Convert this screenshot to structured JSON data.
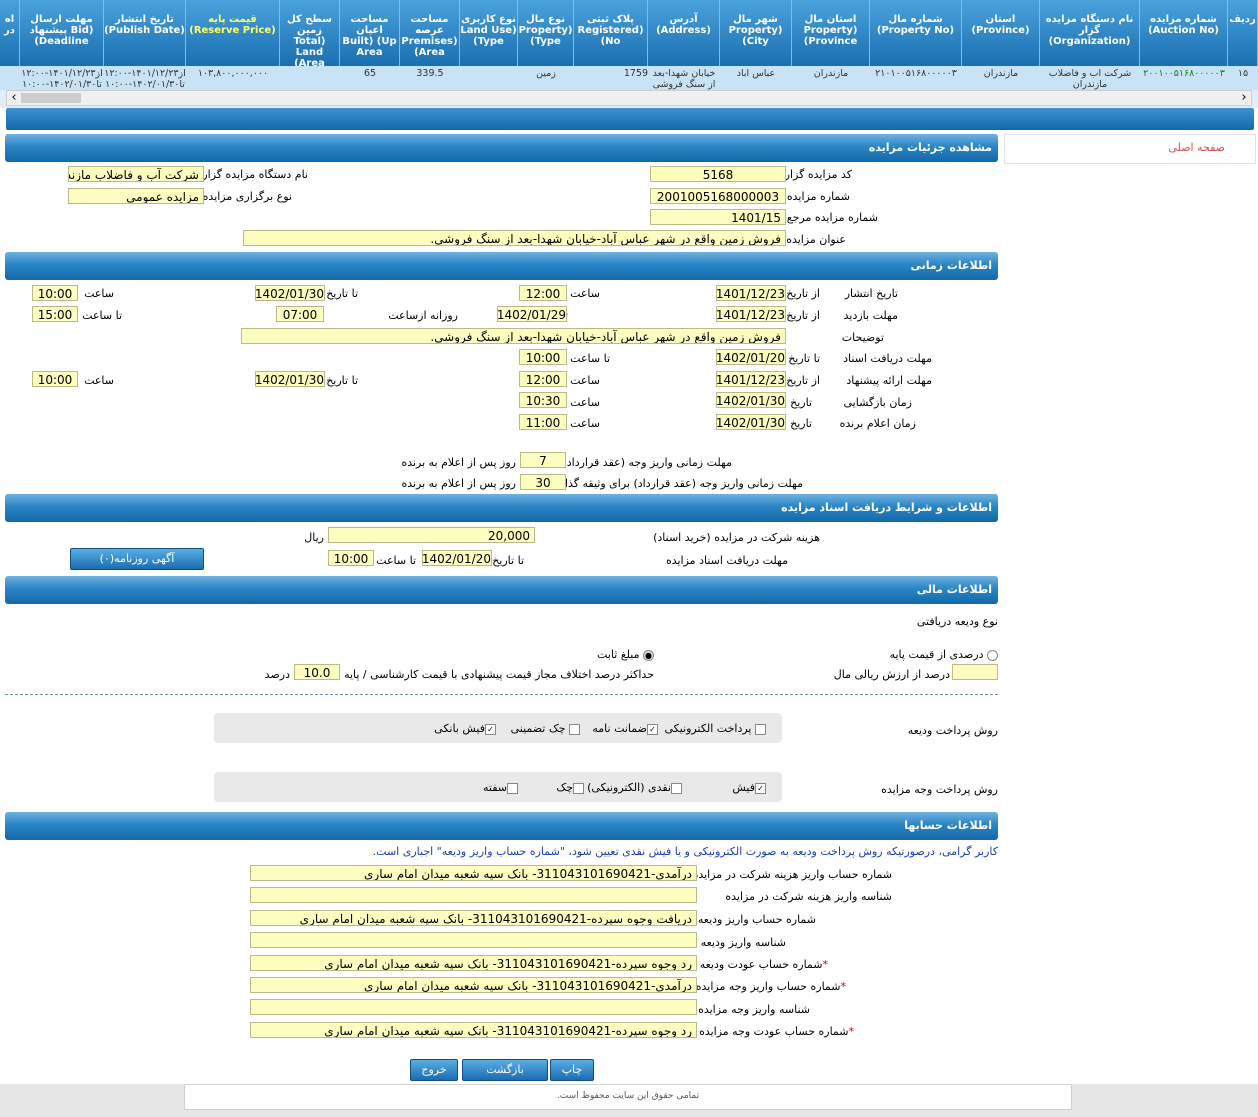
{
  "grid": {
    "headers": [
      "ردیف",
      "شماره مزایده (Auction No)",
      "نام دستگاه مزایده گزار (Organization)",
      "استان (Province)",
      "شماره مال (Property No)",
      "استان مال Property) (Province",
      "شهر مال Property) (City",
      "آدرس (Address)",
      "پلاک ثبتی Registered) (No",
      "نوع مال Property) (Type",
      "نوع کاربری Land Use) (Type",
      "مساحت عرصه Premises) (Area",
      "مساحت اعیان Built) (Up Area",
      "سطح کل زمین Total) Land (Area",
      "قیمت پایه (Reserve Price)",
      "تاریخ انتشار (Publish Date)",
      "مهلت ارسال پیشنهاد Bid) (Deadline",
      "اه در"
    ],
    "row": {
      "index": "۱۵",
      "auction_no": "۲۰۰۱۰۰۵۱۶۸۰۰۰۰۰۳",
      "organization": "شرکت آب و فاضلاب مازندران",
      "province": "مازندران",
      "property_no": "۲۱۰۱۰۰۵۱۶۸۰۰۰۰۰۳",
      "property_province": "مازندران",
      "property_city": "عباس آباد",
      "address": "خیابان شهدا-بعد از سنگ فروشی",
      "registered_no": "1759",
      "property_type": "زمین",
      "land_use": "",
      "premises_area": "339.5",
      "built_area": "65",
      "total_area": "",
      "reserve_price": "۱۰۳,۸۰۰,۰۰۰,۰۰۰",
      "publish_date": "از۱۴۰۱/۱۲/۲۳-۱۲:۰۰ تا۱۴۰۲/۰۱/۳۰-۱۰:۰۰",
      "deadline": "از۱۴۰۱/۱۲/۲۳-۱۲:۰۰ تا۱۴۰۲/۰۱/۳۰-۱۰:۰۰"
    },
    "scroll_left": "‹",
    "scroll_right": "›"
  },
  "home_link": "صفحه اصلی",
  "sections": {
    "details": "مشاهده جزئیات مزایده",
    "time": "اطلاعات زمانی",
    "docs": "اطلاعات و شرایط دریافت اسناد مزایده",
    "financial": "اطلاعات مالی",
    "accounts": "اطلاعات حسابها"
  },
  "details": {
    "org_code_label": "کد مزایده گزار",
    "org_code": "5168",
    "org_name_label": "نام دستگاه مزایده گزار",
    "org_name": "شرکت آب و فاضلاب مازندر",
    "auction_no_label": "شماره مزایده",
    "auction_no": "2001005168000003",
    "holding_type_label": "نوع برگزاری مزایده",
    "holding_type": "مزایده عمومی",
    "ref_no_label": "شماره مزایده مرجع",
    "ref_no": "1401/15",
    "title_label": "عنوان مزایده",
    "title": "فروش زمین واقع در شهر عباس آباد-خیابان شهدا-بعد از سنگ فروشی."
  },
  "time": {
    "publish_label": "تاریخ انتشار",
    "from_date": "از تاریخ",
    "to_date": "تا تاریخ",
    "hour": "ساعت",
    "to_hour": "تا ساعت",
    "date": "تاریخ",
    "publish_from": "1401/12/23",
    "publish_from_time": "12:00",
    "publish_to": "1402/01/30",
    "publish_to_time": "10:00",
    "visit_label": "مهلت بازدید",
    "visit_from": "1401/12/23",
    "visit_to": "1402/01/29",
    "daily_from_label": "روزانه ازساعت",
    "visit_daily_from": "07:00",
    "visit_daily_to": "15:00",
    "description_label": "توضیحات",
    "description": "فروش زمین واقع در شهر عباس آباد-خیابان شهدا-بعد از سنگ فروشی.",
    "doc_deadline_label": "مهلت دریافت اسناد",
    "doc_deadline_date": "1402/01/20",
    "doc_deadline_time": "10:00",
    "bid_label": "مهلت ارائه پیشنهاد",
    "bid_from": "1401/12/23",
    "bid_from_time": "12:00",
    "bid_to": "1402/01/30",
    "bid_to_time": "10:00",
    "opening_label": "زمان بازگشایی",
    "opening_date": "1402/01/30",
    "opening_time": "10:30",
    "winner_label": "زمان اعلام برنده",
    "winner_date": "1402/01/30",
    "winner_time": "11:00",
    "payment_label": "مهلت زمانی واریز وجه (عقد قرارداد)",
    "payment_days": "7",
    "payment_suffix": "روز پس از اعلام به برنده",
    "guarantee_label": "مهلت زمانی واریز وجه (عقد قرارداد) برای وثیقه گذار",
    "guarantee_days": "30",
    "guarantee_suffix": "روز پس از اعلام به برنده"
  },
  "docs": {
    "fee_label": "هزینه شرکت در مزایده (خرید اسناد)",
    "fee": "20,000",
    "currency": "ریال",
    "deadline_label": "مهلت دریافت اسناد مزایده",
    "to_date": "تا تاریخ",
    "deadline_date": "1402/01/20",
    "to_hour": "تا ساعت",
    "deadline_time": "10:00",
    "newspaper_button": "آگهی روزنامه(۰)"
  },
  "financial": {
    "deposit_type_label": "نوع ودیعه دریافتی",
    "percent_of_base": "درصدی از قیمت پایه",
    "fixed_amount": "مبلغ ثابت",
    "percent_of_value_label": "درصد از ارزش ریالی مال",
    "percent_of_value": "",
    "max_diff_label": "حداکثر درصد اختلاف مجاز قیمت پیشنهادی با قیمت کارشناسی / پایه",
    "max_diff": "10.0",
    "percent": "درصد",
    "deposit_method_label": "روش پرداخت ودیعه",
    "deposit_methods": [
      {
        "label": "پرداخت الکترونیکی",
        "checked": false
      },
      {
        "label": "ضمانت نامه",
        "checked": true
      },
      {
        "label": "چک تضمینی",
        "checked": false
      },
      {
        "label": "فیش بانکی",
        "checked": true
      }
    ],
    "payment_method_label": "روش پرداخت وجه مزایده",
    "payment_methods": [
      {
        "label": "فیش",
        "checked": true
      },
      {
        "label": "نقدی (الکترونیکی)",
        "checked": false
      },
      {
        "label": "چک",
        "checked": false
      },
      {
        "label": "سفته",
        "checked": false
      }
    ]
  },
  "accounts": {
    "notice": "کاربر گرامی، درصورتیکه روش پرداخت ودیعه به صورت الکترونیکی و یا فیش نقدی تعیین شود، \"شماره حساب واریز ودیعه\" اجباری است.",
    "rows": [
      {
        "label": "شماره حساب واریز هزینه شرکت در مزایده",
        "value": "درآمدی-311043101690421- بانک سپه شعبه میدان امام ساری",
        "required": false
      },
      {
        "label": "شناسه واریز هزینه شرکت در مزایده",
        "value": "",
        "required": false
      },
      {
        "label": "شماره حساب واریز ودیعه",
        "value": "دریافت وجوه سپرده-311043101690421- بانک سپه شعبه میدان امام ساری",
        "required": false
      },
      {
        "label": "شناسه واریز ودیعه",
        "value": "",
        "required": false
      },
      {
        "label": "شماره حساب عودت ودیعه",
        "value": "رد وجوه سپرده-311043101690421- بانک سپه شعبه میدان امام ساری",
        "required": true
      },
      {
        "label": "شماره حساب واریز وجه مزایده",
        "value": "درآمدی-311043101690421- بانک سپه شعبه میدان امام ساری",
        "required": true
      },
      {
        "label": "شناسه واریز وجه مزایده",
        "value": "",
        "required": false
      },
      {
        "label": "شماره حساب عودت وجه مزایده",
        "value": "رد وجوه سپرده-311043101690421- بانک سپه شعبه میدان امام ساری",
        "required": true
      }
    ]
  },
  "buttons": {
    "print": "چاپ",
    "back": "بازگشت",
    "exit": "خروج"
  },
  "footer": "تمامی حقوق این سایت محفوظ است."
}
